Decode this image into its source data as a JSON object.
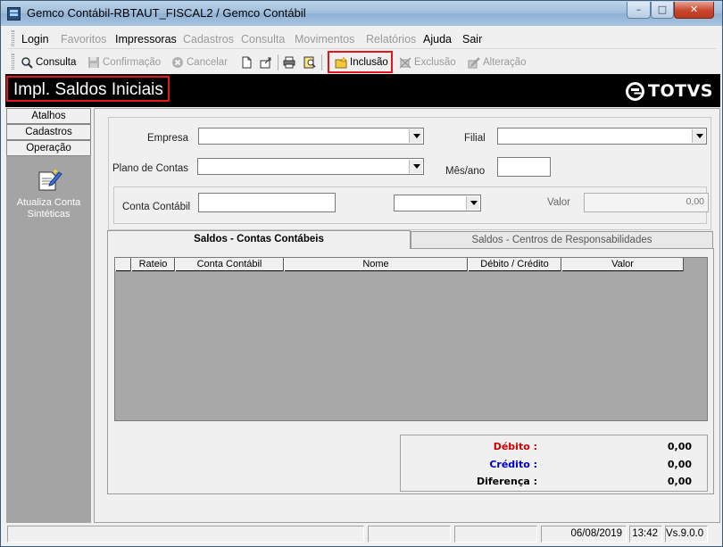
{
  "window": {
    "title": "Gemco Contábil-RBTAUT_FISCAL2 / Gemco Contábil",
    "controls": {
      "minimize": "–",
      "maximize": "□",
      "close": "✕"
    }
  },
  "menu": {
    "items": [
      {
        "label": "Login",
        "enabled": true
      },
      {
        "label": "Favoritos",
        "enabled": false
      },
      {
        "label": "Impressoras",
        "enabled": true
      },
      {
        "label": "Cadastros",
        "enabled": false
      },
      {
        "label": "Consulta",
        "enabled": false
      },
      {
        "label": "Movimentos",
        "enabled": false
      },
      {
        "label": "Relatórios",
        "enabled": false
      },
      {
        "label": "Ajuda",
        "enabled": true
      },
      {
        "label": "Sair",
        "enabled": true
      }
    ]
  },
  "toolbar": {
    "consulta": "Consulta",
    "confirmacao": "Confirmação",
    "cancelar": "Cancelar",
    "inclusao": "Inclusão",
    "exclusao": "Exclusão",
    "alteracao": "Alteração"
  },
  "banner": {
    "title": "Impl. Saldos Iniciais",
    "brand": "TOTVS"
  },
  "sidebar": {
    "atalhos": "Atalhos",
    "cadastros": "Cadastros",
    "operacao": "Operação",
    "tool_label": "Atualiza Conta Sintéticas"
  },
  "form": {
    "empresa_label": "Empresa",
    "empresa_value": "",
    "filial_label": "Filial",
    "filial_value": "",
    "plano_label": "Plano de Contas",
    "plano_value": "",
    "mesano_label": "Mês/ano",
    "mesano_value": "",
    "conta_label": "Conta Contábil",
    "conta_value": "",
    "dc_value": "",
    "valor_label": "Valor",
    "valor_value": "0,00"
  },
  "tabs": {
    "active": "Saldos - Contas Contábeis",
    "inactive": "Saldos - Centros de Responsabilidades"
  },
  "grid": {
    "columns": [
      "Rateio",
      "Conta Contábil",
      "Nome",
      "Débito  / Crédito",
      "Valor"
    ],
    "rows": []
  },
  "totals": {
    "debito_label": "Débito :",
    "debito_value": "0,00",
    "credito_label": "Crédito :",
    "credito_value": "0,00",
    "diferenca_label": "Diferença :",
    "diferenca_value": "0,00",
    "colors": {
      "debito": "#cc0000",
      "credito": "#0000cc",
      "diferenca": "#000000"
    }
  },
  "status": {
    "date": "06/08/2019",
    "time": "13:42",
    "version": "Vs.9.0.0"
  }
}
